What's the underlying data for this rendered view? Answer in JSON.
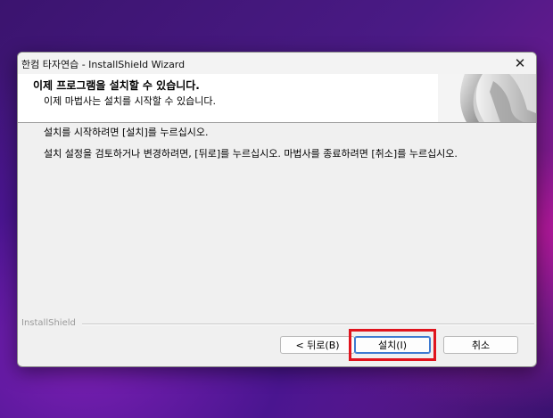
{
  "window": {
    "title": "한컴 타자연습 - InstallShield Wizard",
    "close_glyph": "✕"
  },
  "header": {
    "title": "이제 프로그램을 설치할 수 있습니다.",
    "subtitle": "이제 마법사는 설치를 시작할 수 있습니다."
  },
  "body": {
    "line1": "설치를 시작하려면 [설치]를 누르십시오.",
    "line2": "설치 설정을 검토하거나 변경하려면, [뒤로]를 누르십시오. 마법사를 종료하려면 [취소]를 누르십시오."
  },
  "footer": {
    "brand": "InstallShield"
  },
  "buttons": {
    "back": "< 뒤로(B)",
    "install": "설치(I)",
    "cancel": "취소"
  },
  "colors": {
    "highlight": "#e0141e",
    "default_button_border": "#3d7ad1"
  }
}
